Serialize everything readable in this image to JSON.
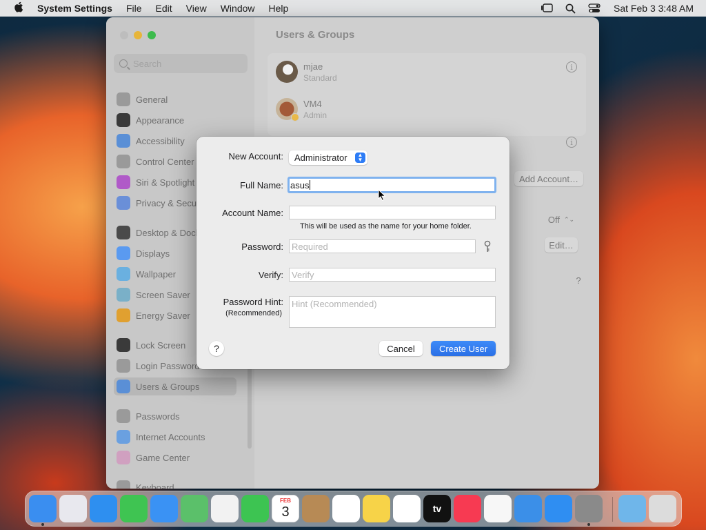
{
  "menubar": {
    "app_name": "System Settings",
    "menus": [
      "File",
      "Edit",
      "View",
      "Window",
      "Help"
    ],
    "clock": "Sat Feb 3  3:48 AM"
  },
  "window": {
    "title": "Users & Groups",
    "search_placeholder": "Search",
    "sidebar": [
      {
        "label": "General",
        "icon": "gear-icon",
        "color": "#9a9a9a"
      },
      {
        "label": "Appearance",
        "icon": "appearance-icon",
        "color": "#3a3a3a"
      },
      {
        "label": "Accessibility",
        "icon": "accessibility-icon",
        "color": "#5a8fd6"
      },
      {
        "label": "Control Center",
        "icon": "control-center-icon",
        "color": "#9a9a9a"
      },
      {
        "label": "Siri & Spotlight",
        "icon": "siri-icon",
        "color": "#b05ac8"
      },
      {
        "label": "Privacy & Security",
        "icon": "privacy-hand-icon",
        "color": "#6a8fd8"
      },
      {
        "label": "Desktop & Dock",
        "icon": "desktop-dock-icon",
        "color": "#4a4a4a"
      },
      {
        "label": "Displays",
        "icon": "displays-icon",
        "color": "#5a9af0"
      },
      {
        "label": "Wallpaper",
        "icon": "wallpaper-icon",
        "color": "#6ab0e0"
      },
      {
        "label": "Screen Saver",
        "icon": "screen-saver-icon",
        "color": "#7ab0c8"
      },
      {
        "label": "Energy Saver",
        "icon": "energy-saver-icon",
        "color": "#e0a030"
      },
      {
        "label": "Lock Screen",
        "icon": "lock-icon",
        "color": "#3a3a3a"
      },
      {
        "label": "Login Password",
        "icon": "login-password-icon",
        "color": "#9a9a9a"
      },
      {
        "label": "Users & Groups",
        "icon": "users-icon",
        "color": "#5a8fd6"
      },
      {
        "label": "Passwords",
        "icon": "key-icon",
        "color": "#9a9a9a"
      },
      {
        "label": "Internet Accounts",
        "icon": "at-icon",
        "color": "#6aa0e0"
      },
      {
        "label": "Game Center",
        "icon": "game-center-icon",
        "color": "#d0a0c0"
      },
      {
        "label": "Keyboard",
        "icon": "keyboard-icon",
        "color": "#9a9a9a"
      }
    ],
    "users": [
      {
        "name": "mjae",
        "role": "Standard"
      },
      {
        "name": "VM4",
        "role": "Admin"
      }
    ],
    "add_account_label": "Add Account…",
    "guest_toggle_value": "Off",
    "edit_label": "Edit…",
    "help_glyph": "?"
  },
  "dialog": {
    "new_account_label": "New Account:",
    "new_account_value": "Administrator",
    "full_name_label": "Full Name:",
    "full_name_value": "asus",
    "account_name_label": "Account Name:",
    "account_name_value": "",
    "account_name_note": "This will be used as the name for your home folder.",
    "password_label": "Password:",
    "password_placeholder": "Required",
    "verify_label": "Verify:",
    "verify_placeholder": "Verify",
    "hint_label": "Password Hint:",
    "hint_sublabel": "(Recommended)",
    "hint_placeholder": "Hint (Recommended)",
    "help_glyph": "?",
    "cancel_label": "Cancel",
    "create_label": "Create User"
  },
  "dock": [
    {
      "name": "Finder",
      "icon": "finder-icon",
      "color": "#3a8ef0",
      "running": true
    },
    {
      "name": "Launchpad",
      "icon": "launchpad-icon",
      "color": "#e8e8ee",
      "running": false
    },
    {
      "name": "Safari",
      "icon": "safari-icon",
      "color": "#2e8ff0",
      "running": false
    },
    {
      "name": "Messages",
      "icon": "messages-icon",
      "color": "#3fc452",
      "running": false
    },
    {
      "name": "Mail",
      "icon": "mail-icon",
      "color": "#3a92f4",
      "running": false
    },
    {
      "name": "Maps",
      "icon": "maps-icon",
      "color": "#5bc06a",
      "running": false
    },
    {
      "name": "Photos",
      "icon": "photos-icon",
      "color": "#f2f2f2",
      "running": false
    },
    {
      "name": "FaceTime",
      "icon": "facetime-icon",
      "color": "#3dc452",
      "running": false
    },
    {
      "name": "Calendar",
      "icon": "calendar-icon",
      "color": "#ffffff",
      "running": false,
      "month": "FEB",
      "day": "3"
    },
    {
      "name": "Contacts",
      "icon": "contacts-icon",
      "color": "#b78a55",
      "running": false
    },
    {
      "name": "Reminders",
      "icon": "reminders-icon",
      "color": "#ffffff",
      "running": false
    },
    {
      "name": "Notes",
      "icon": "notes-icon",
      "color": "#f7d348",
      "running": false
    },
    {
      "name": "Freeform",
      "icon": "freeform-icon",
      "color": "#ffffff",
      "running": false
    },
    {
      "name": "TV",
      "icon": "tv-icon",
      "color": "#111111",
      "running": false,
      "text": "tv"
    },
    {
      "name": "Music",
      "icon": "music-icon",
      "color": "#f73a52",
      "running": false
    },
    {
      "name": "News",
      "icon": "news-icon",
      "color": "#f7f7f7",
      "running": false
    },
    {
      "name": "Keynote",
      "icon": "keynote-icon",
      "color": "#3b8fe8",
      "running": false
    },
    {
      "name": "App Store",
      "icon": "app-store-icon",
      "color": "#2f8ef2",
      "running": false
    },
    {
      "name": "System Settings",
      "icon": "system-settings-icon",
      "color": "#8a8a8a",
      "running": true
    },
    {
      "name": "Downloads",
      "icon": "downloads-folder-icon",
      "color": "#6fb6ea",
      "running": false
    },
    {
      "name": "Trash",
      "icon": "trash-icon",
      "color": "#dcdcdc",
      "running": false
    }
  ]
}
